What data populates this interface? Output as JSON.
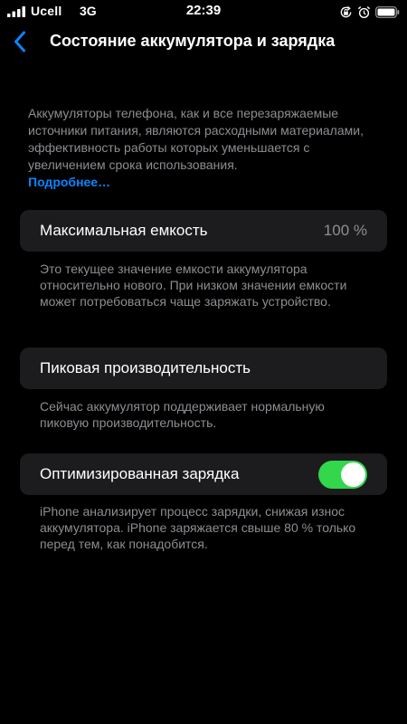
{
  "status_bar": {
    "carrier": "Ucell",
    "network": "3G",
    "time": "22:39",
    "icons": [
      "signal-bars-icon",
      "orientation-lock-icon",
      "alarm-icon",
      "battery-icon"
    ]
  },
  "nav": {
    "back_icon": "chevron-left-icon",
    "title": "Состояние аккумулятора и зарядка"
  },
  "intro": {
    "text": "Аккумуляторы телефона, как и все перезаряжаемые источники питания, являются расходными материалами, эффективность работы которых уменьшается с увеличением срока использования.",
    "link": "Подробнее…"
  },
  "max_capacity": {
    "label": "Максимальная емкость",
    "value": "100 %",
    "footnote": "Это текущее значение емкости аккумулятора относительно нового. При низком значении емкости может потребоваться чаще заряжать устройство."
  },
  "peak_performance": {
    "label": "Пиковая производительность",
    "footnote": "Сейчас аккумулятор поддерживает нормальную пиковую производительность."
  },
  "optimized_charging": {
    "label": "Оптимизированная зарядка",
    "enabled": true,
    "footnote": "iPhone анализирует процесс зарядки, снижая износ аккумулятора. iPhone заряжается свыше 80 % только перед тем, как понадобится."
  },
  "colors": {
    "background": "#000000",
    "card": "#1c1c1e",
    "secondary_text": "#8d8d93",
    "link": "#0a84ff",
    "toggle_on": "#32d74b"
  }
}
